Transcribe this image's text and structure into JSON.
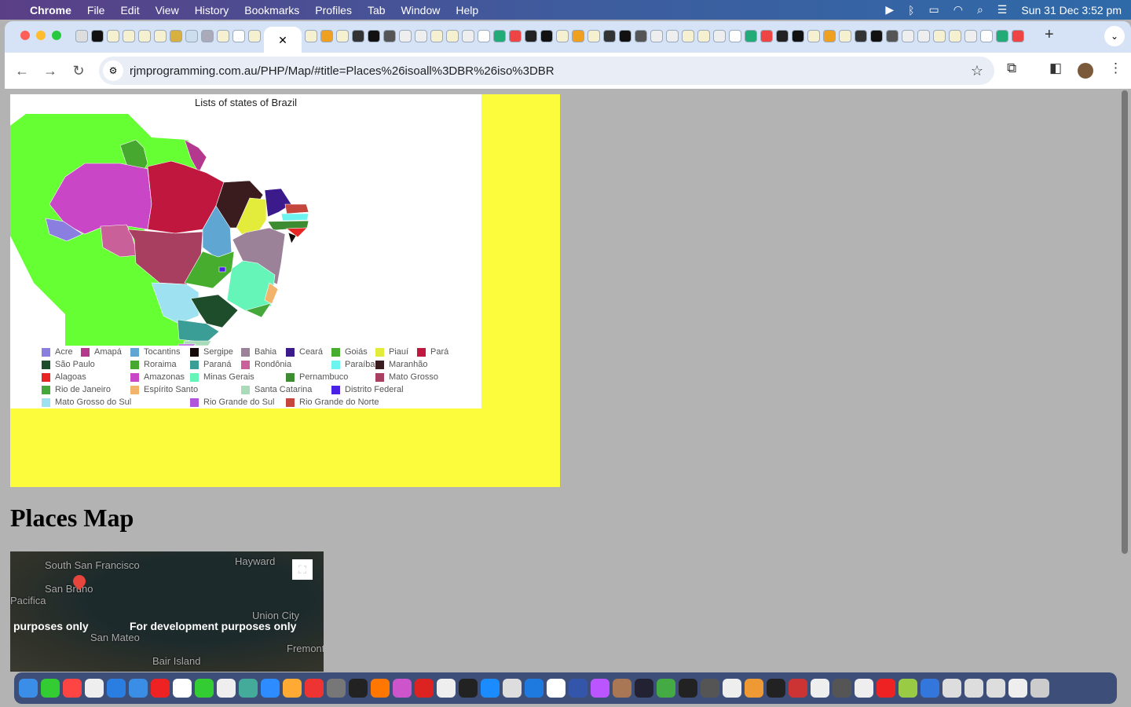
{
  "menubar": {
    "app": "Chrome",
    "items": [
      "File",
      "Edit",
      "View",
      "History",
      "Bookmarks",
      "Profiles",
      "Tab",
      "Window",
      "Help"
    ],
    "datetime": "Sun 31 Dec  3:52 pm"
  },
  "browser": {
    "active_tab_close": "✕",
    "new_tab": "+",
    "url": "rjmprogramming.com.au/PHP/Map/#title=Places%26isoall%3DBR%26iso%3DBR"
  },
  "chart": {
    "title": "Lists of states of Brazil",
    "legend": [
      {
        "name": "Acre",
        "color": "#8a7fe0"
      },
      {
        "name": "Amapá",
        "color": "#b5388f"
      },
      {
        "name": "Tocantins",
        "color": "#5fa6d3"
      },
      {
        "name": "Sergipe",
        "color": "#140a0a"
      },
      {
        "name": "Bahia",
        "color": "#9b8299"
      },
      {
        "name": "Ceará",
        "color": "#3b1a8c"
      },
      {
        "name": "Goiás",
        "color": "#46ad2e"
      },
      {
        "name": "Piauí",
        "color": "#e3ec3b"
      },
      {
        "name": "Pará",
        "color": "#c0173f"
      },
      {
        "name": "São Paulo",
        "color": "#1e4d2b"
      },
      {
        "name": "Roraima",
        "color": "#47a830"
      },
      {
        "name": "Paraná",
        "color": "#3b9e96"
      },
      {
        "name": "Rondônia",
        "color": "#c96099"
      },
      {
        "name": "Paraíba",
        "color": "#6cf4f0"
      },
      {
        "name": "Maranhão",
        "color": "#3a1c1e"
      },
      {
        "name": "Alagoas",
        "color": "#e82525"
      },
      {
        "name": "Amazonas",
        "color": "#c947c6"
      },
      {
        "name": "Minas Gerais",
        "color": "#66f5b8"
      },
      {
        "name": "Pernambuco",
        "color": "#3d8c32"
      },
      {
        "name": "Mato Grosso",
        "color": "#a83f60"
      },
      {
        "name": "Rio de Janeiro",
        "color": "#45a83a"
      },
      {
        "name": "Espírito Santo",
        "color": "#f2b36b"
      },
      {
        "name": "Santa Catarina",
        "color": "#a9dbb8"
      },
      {
        "name": "Distrito Federal",
        "color": "#4a22e6"
      },
      {
        "name": "Mato Grosso do Sul",
        "color": "#9ee2f2"
      },
      {
        "name": "Rio Grande do Sul",
        "color": "#b255dd"
      },
      {
        "name": "Rio Grande do Norte",
        "color": "#c4463c"
      }
    ],
    "background_color": "#66ff33"
  },
  "places": {
    "title": "Places Map"
  },
  "google_map": {
    "labels": [
      "South San Francisco",
      "San Bruno",
      "Pacifica",
      "Hayward",
      "Union City",
      "San Mateo",
      "Bair Island",
      "Fremont"
    ],
    "watermark": "For development purposes only",
    "watermark_partial": "purposes only"
  }
}
